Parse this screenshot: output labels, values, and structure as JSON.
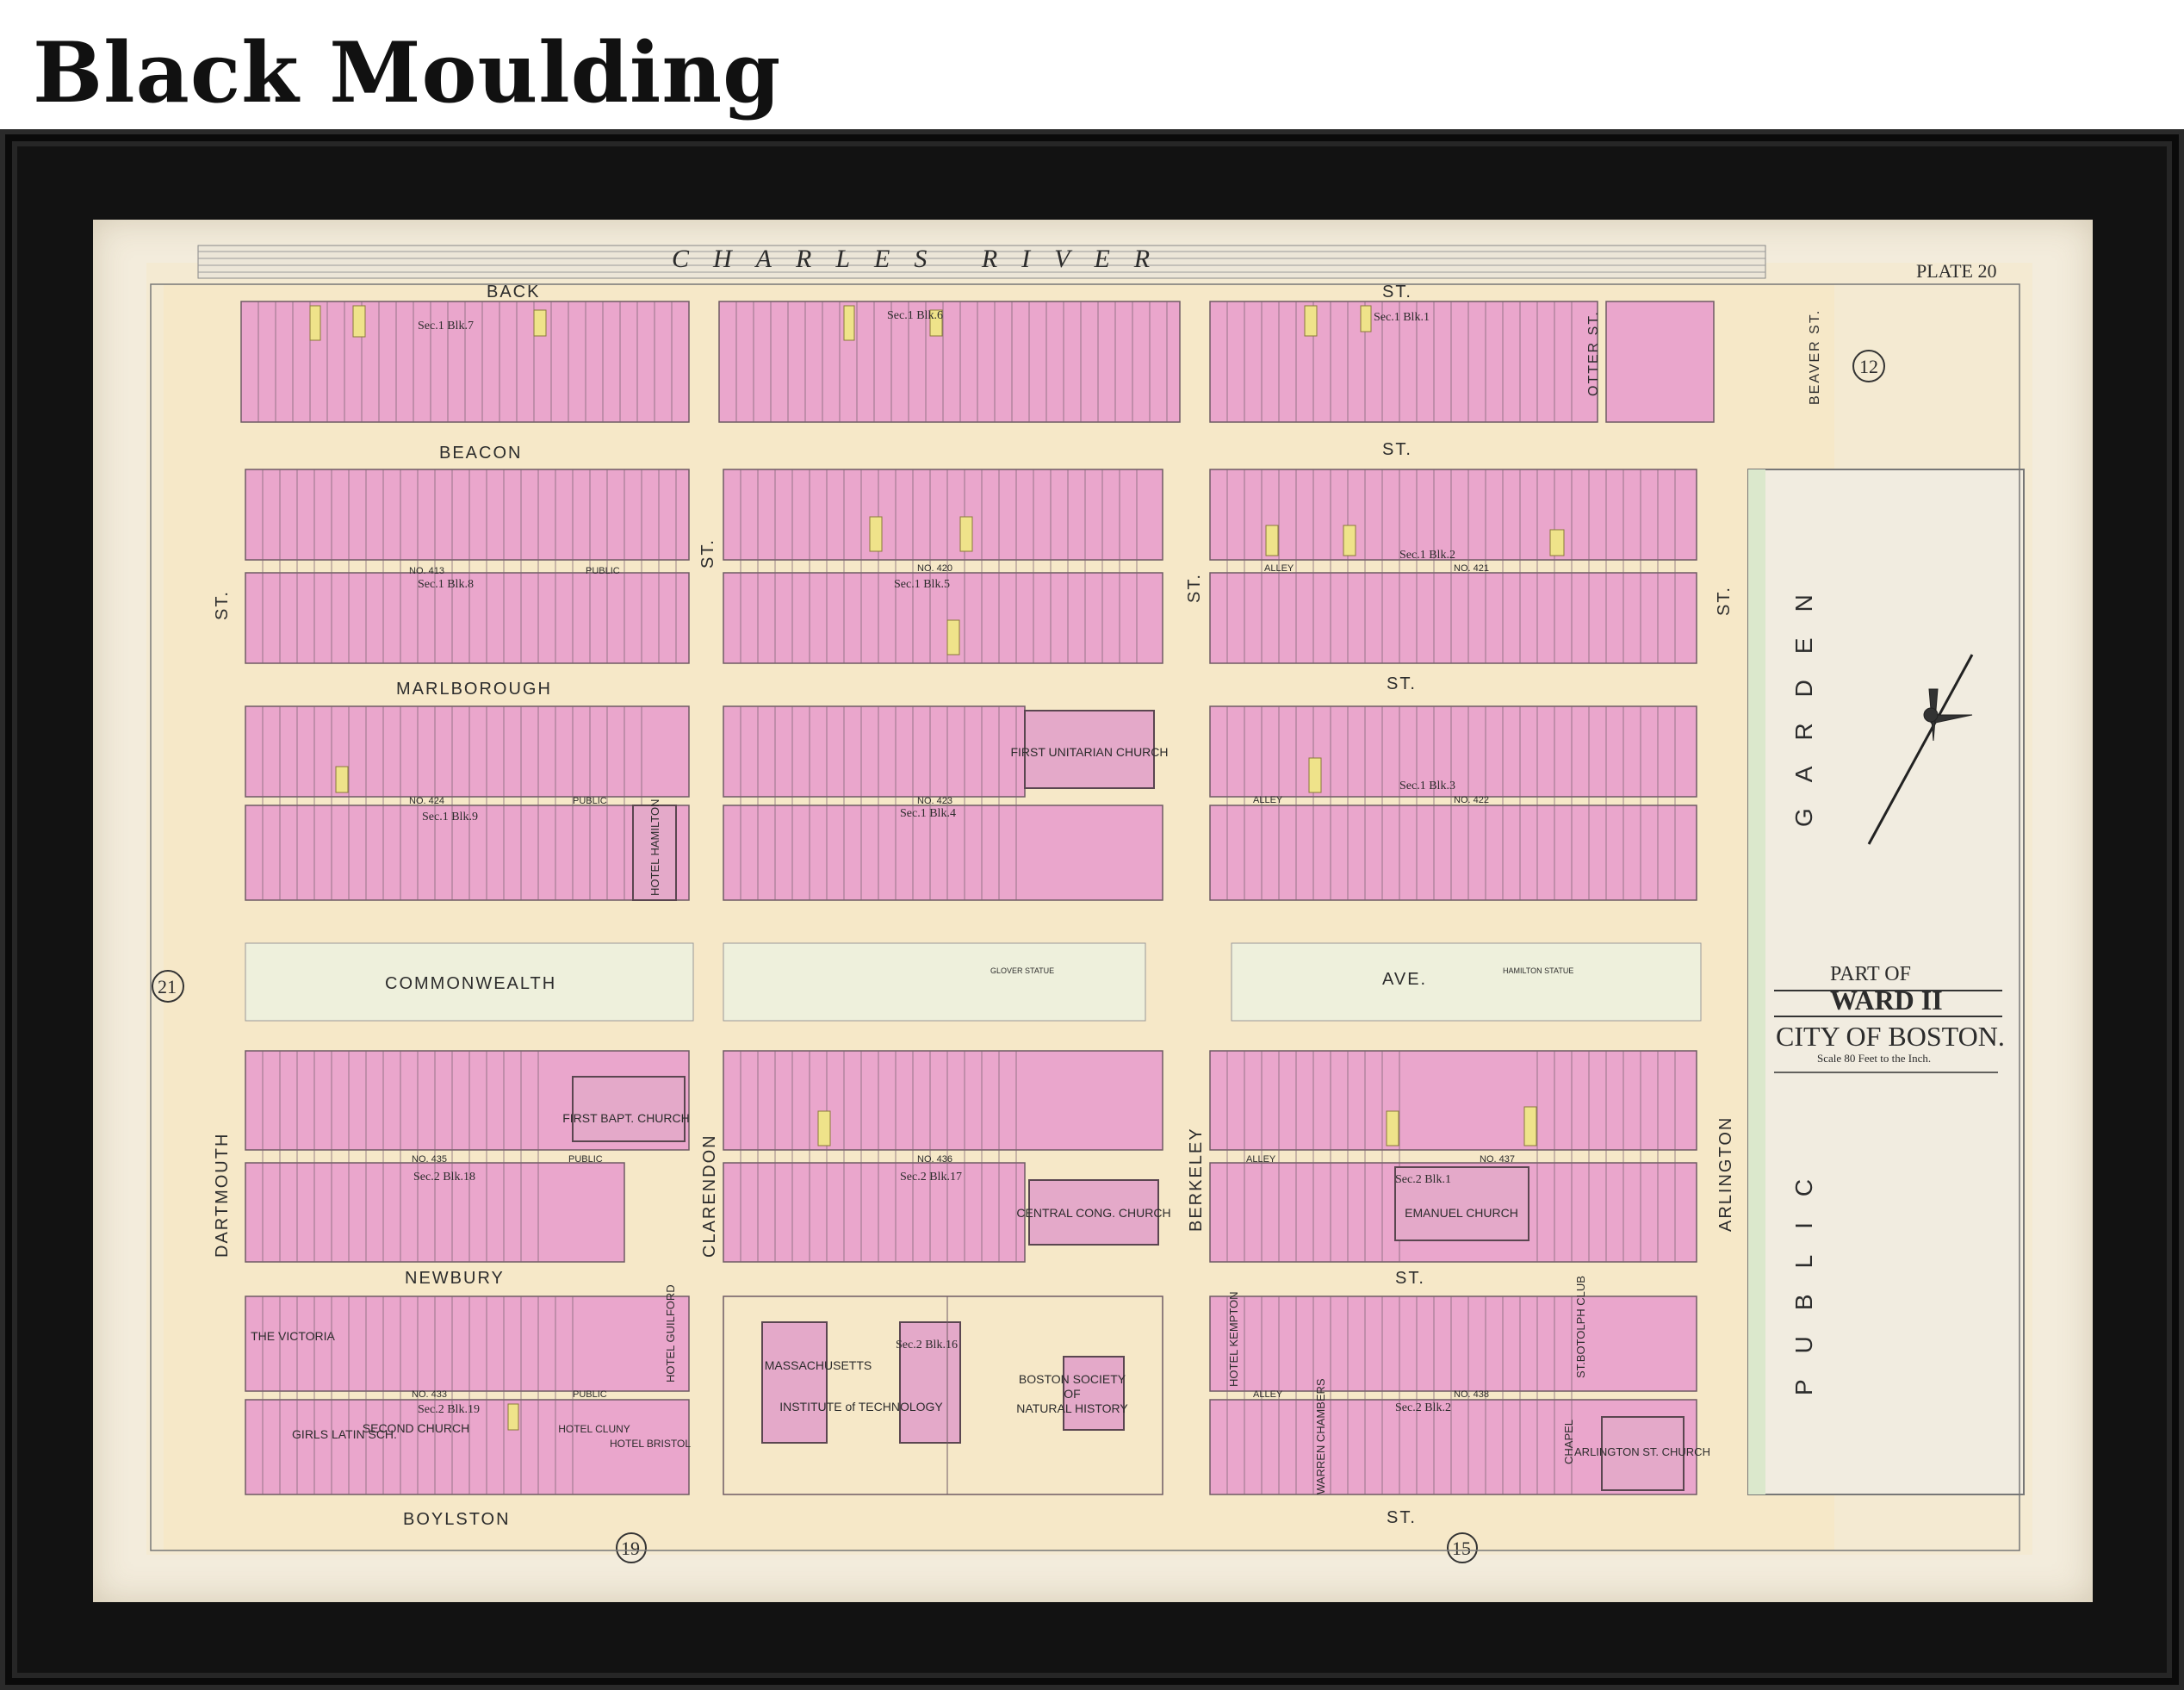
{
  "header": {
    "title": "Black Moulding"
  },
  "map": {
    "river": "CHARLES RIVER",
    "plate": "PLATE 20",
    "ward_circle_right": "12",
    "ward_circle_left": "21",
    "ward_circle_bottom_left": "19",
    "ward_circle_bottom_right": "15",
    "streets": {
      "back": "BACK",
      "back_st": "ST.",
      "beacon": "BEACON",
      "beacon_st": "ST.",
      "marlborough": "MARLBOROUGH",
      "marlborough_st": "ST.",
      "commonwealth": "COMMONWEALTH",
      "commonwealth_ave": "AVE.",
      "newbury": "NEWBURY",
      "newbury_st": "ST.",
      "boylston": "BOYLSTON",
      "boylston_st": "ST.",
      "dartmouth": "DARTMOUTH",
      "dartmouth_st": "ST.",
      "clarendon": "CLARENDON",
      "clarendon_st": "ST.",
      "berkeley": "BERKELEY",
      "berkeley_st": "ST.",
      "arlington": "ARLINGTON",
      "arlington_st": "ST.",
      "otter": "OTTER ST.",
      "beaver": "BEAVER ST."
    },
    "garden": {
      "upper": "GARDEN",
      "lower": "PUBLIC"
    },
    "buildings": {
      "first_unitarian": "FIRST UNITARIAN CHURCH",
      "hotel_hamilton": "HOTEL HAMILTON",
      "first_bapt": "FIRST BAPT. CHURCH",
      "central_cong": "CENTRAL CONG. CHURCH",
      "emanuel": "EMANUEL CHURCH",
      "the_victoria": "THE VICTORIA",
      "mit_1": "MASSACHUSETTS",
      "mit_2": "INSTITUTE of TECHNOLOGY",
      "bsnh_1": "BOSTON SOCIETY",
      "bsnh_2": "OF",
      "bsnh_3": "NATURAL HISTORY",
      "girls_latin": "GIRLS LATIN SCH.",
      "second_church": "SECOND CHURCH",
      "hotel_cluny": "HOTEL CLUNY",
      "hotel_bristol": "HOTEL BRISTOL",
      "arlington_church": "ARLINGTON ST. CHURCH",
      "chapel": "CHAPEL",
      "hotel_kempton": "HOTEL KEMPTON",
      "warren_chambers": "WARREN CHAMBERS",
      "st_botolph": "ST.BOTOLPH CLUB",
      "hotel_guilford": "HOTEL GUILFORD"
    },
    "sections": {
      "b7": "Sec.1 Blk.7",
      "b6": "Sec.1 Blk.6",
      "b1": "Sec.1 Blk.1",
      "b8": "Sec.1 Blk.8",
      "b5": "Sec.1 Blk.5",
      "b2": "Sec.1 Blk.2",
      "b9": "Sec.1 Blk.9",
      "b4": "Sec.1 Blk.4",
      "b3": "Sec.1 Blk.3",
      "s2b18": "Sec.2 Blk.18",
      "s2b17": "Sec.2 Blk.17",
      "s2b1": "Sec.2 Blk.1",
      "s2b16": "Sec.2 Blk.16",
      "s2b19": "Sec.2 Blk.19",
      "s2b2": "Sec.2 Blk.2"
    },
    "alleys": {
      "a420": "NO. 420",
      "a413": "NO. 413",
      "a421": "NO. 421",
      "a424": "NO. 424",
      "a423": "NO. 423",
      "a422": "NO. 422",
      "a435": "NO. 435",
      "a436": "NO. 436",
      "a437": "NO. 437",
      "a433": "NO. 433",
      "a438": "NO. 438",
      "public": "PUBLIC",
      "alley": "ALLEY"
    },
    "statues": {
      "glover": "GLOVER STATUE",
      "hamilton": "HAMILTON STATUE"
    },
    "cartouche": {
      "part_of": "PART OF",
      "ward": "WARD II",
      "city": "CITY OF BOSTON.",
      "scale": "Scale 80 Feet to the Inch."
    }
  }
}
